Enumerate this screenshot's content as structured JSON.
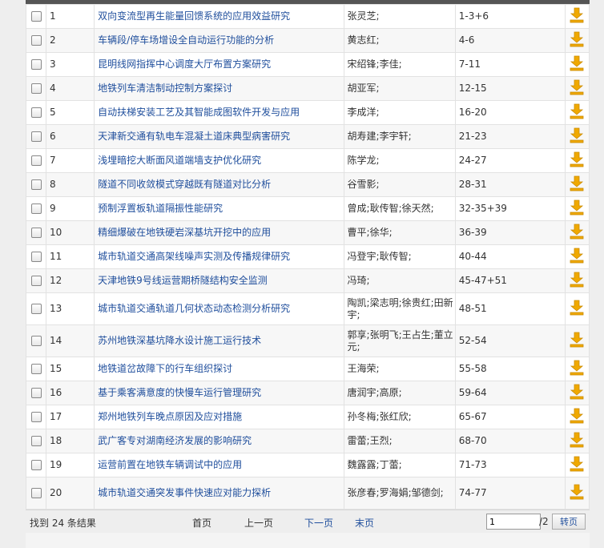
{
  "colors": {
    "link": "#1f4e9c",
    "download_icon": "#f0a900",
    "header_bar": "#555555",
    "pager_bg": "#eeeeee"
  },
  "icons": {
    "checkbox": "checkbox-icon",
    "download": "download-arrow-icon"
  },
  "rows": [
    {
      "num": "1",
      "title": "双向变流型再生能量回馈系统的应用效益研究",
      "authors": "张灵芝;",
      "pages": "1-3+6"
    },
    {
      "num": "2",
      "title": "车辆段/停车场增设全自动运行功能的分析",
      "authors": "黄志红;",
      "pages": "4-6"
    },
    {
      "num": "3",
      "title": "昆明线网指挥中心调度大厅布置方案研究",
      "authors": "宋绍锋;李佳;",
      "pages": "7-11"
    },
    {
      "num": "4",
      "title": "地铁列车清洁制动控制方案探讨",
      "authors": "胡亚军;",
      "pages": "12-15"
    },
    {
      "num": "5",
      "title": "自动扶梯安装工艺及其智能成图软件开发与应用",
      "authors": "李成洋;",
      "pages": "16-20"
    },
    {
      "num": "6",
      "title": "天津新交通有轨电车混凝土道床典型病害研究",
      "authors": "胡寿建;李宇轩;",
      "pages": "21-23"
    },
    {
      "num": "7",
      "title": "浅埋暗挖大断面风道端墙支护优化研究",
      "authors": "陈学龙;",
      "pages": "24-27"
    },
    {
      "num": "8",
      "title": "隧道不同收敛模式穿越既有隧道对比分析",
      "authors": "谷雪影;",
      "pages": "28-31"
    },
    {
      "num": "9",
      "title": "预制浮置板轨道隔振性能研究",
      "authors": "曾成;耿传智;徐天然;",
      "pages": "32-35+39"
    },
    {
      "num": "10",
      "title": "精细爆破在地铁硬岩深基坑开挖中的应用",
      "authors": "曹平;徐华;",
      "pages": "36-39"
    },
    {
      "num": "11",
      "title": "城市轨道交通高架线噪声实测及传播规律研究",
      "authors": "冯登宇;耿传智;",
      "pages": "40-44"
    },
    {
      "num": "12",
      "title": "天津地铁9号线运营期桥隧结构安全监测",
      "authors": "冯琦;",
      "pages": "45-47+51"
    },
    {
      "num": "13",
      "title": "城市轨道交通轨道几何状态动态检测分析研究",
      "authors": "陶凯;梁志明;徐贵红;田新宇;",
      "pages": "48-51"
    },
    {
      "num": "14",
      "title": "苏州地铁深基坑降水设计施工运行技术",
      "authors": "郭享;张明飞;王占生;董立元;",
      "pages": "52-54"
    },
    {
      "num": "15",
      "title": "地铁道岔故障下的行车组织探讨",
      "authors": "王海荣;",
      "pages": "55-58"
    },
    {
      "num": "16",
      "title": "基于乘客满意度的快慢车运行管理研究",
      "authors": "唐润宇;高原;",
      "pages": "59-64"
    },
    {
      "num": "17",
      "title": "郑州地铁列车晚点原因及应对措施",
      "authors": "孙冬梅;张红欣;",
      "pages": "65-67"
    },
    {
      "num": "18",
      "title": "武广客专对湖南经济发展的影响研究",
      "authors": "雷蕾;王烈;",
      "pages": "68-70"
    },
    {
      "num": "19",
      "title": "运营前置在地铁车辆调试中的应用",
      "authors": "魏露露;丁蕾;",
      "pages": "71-73"
    },
    {
      "num": "20",
      "title": "城市轨道交通突发事件快速应对能力探析",
      "authors": "张彦春;罗海娟;邹德剑;",
      "pages": "74-77"
    }
  ],
  "pager": {
    "found_text": "找到 24 条结果",
    "first": "首页",
    "prev": "上一页",
    "next": "下一页",
    "last": "末页",
    "page_value": "1",
    "total_text": "/2",
    "go_label": "转页"
  }
}
